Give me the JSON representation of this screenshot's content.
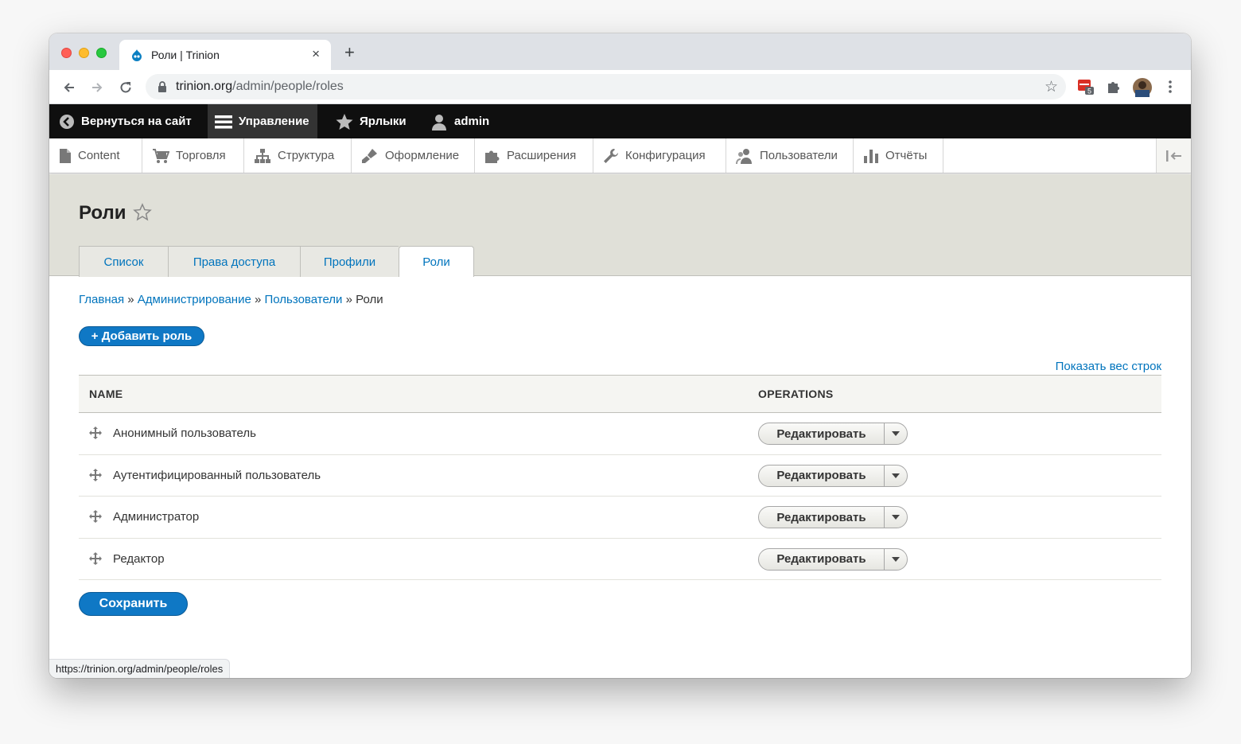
{
  "browser": {
    "tab_title": "Роли | Trinion",
    "tab_close": "×",
    "new_tab": "+",
    "url_domain": "trinion.org",
    "url_path": "/admin/people/roles",
    "ext_badge": "5",
    "status_url": "https://trinion.org/admin/people/roles"
  },
  "admin_toolbar": {
    "back_to_site": "Вернуться на сайт",
    "manage": "Управление",
    "shortcuts": "Ярлыки",
    "user": "admin"
  },
  "tray": {
    "items": [
      "Content",
      "Торговля",
      "Структура",
      "Оформление",
      "Расширения",
      "Конфигурация",
      "Пользователи",
      "Отчёты"
    ]
  },
  "page": {
    "title": "Роли",
    "tabs": [
      "Список",
      "Права доступа",
      "Профили",
      "Роли"
    ],
    "active_tab": "Роли",
    "breadcrumb": [
      "Главная",
      "Администрирование",
      "Пользователи",
      "Роли"
    ],
    "breadcrumb_sep": "»",
    "add_role": "+ Добавить роль",
    "show_weights": "Показать вес строк",
    "table": {
      "headers": [
        "NAME",
        "OPERATIONS"
      ],
      "rows": [
        {
          "name": "Анонимный пользователь",
          "operation": "Редактировать"
        },
        {
          "name": "Аутентифицированный пользователь",
          "operation": "Редактировать"
        },
        {
          "name": "Администратор",
          "operation": "Редактировать"
        },
        {
          "name": "Редактор",
          "operation": "Редактировать"
        }
      ]
    },
    "save": "Сохранить"
  },
  "colors": {
    "link": "#0074bd",
    "primary_button": "#0f78c5",
    "admin_bar": "#0f0f0f",
    "header_bg": "#e0e0d8"
  }
}
